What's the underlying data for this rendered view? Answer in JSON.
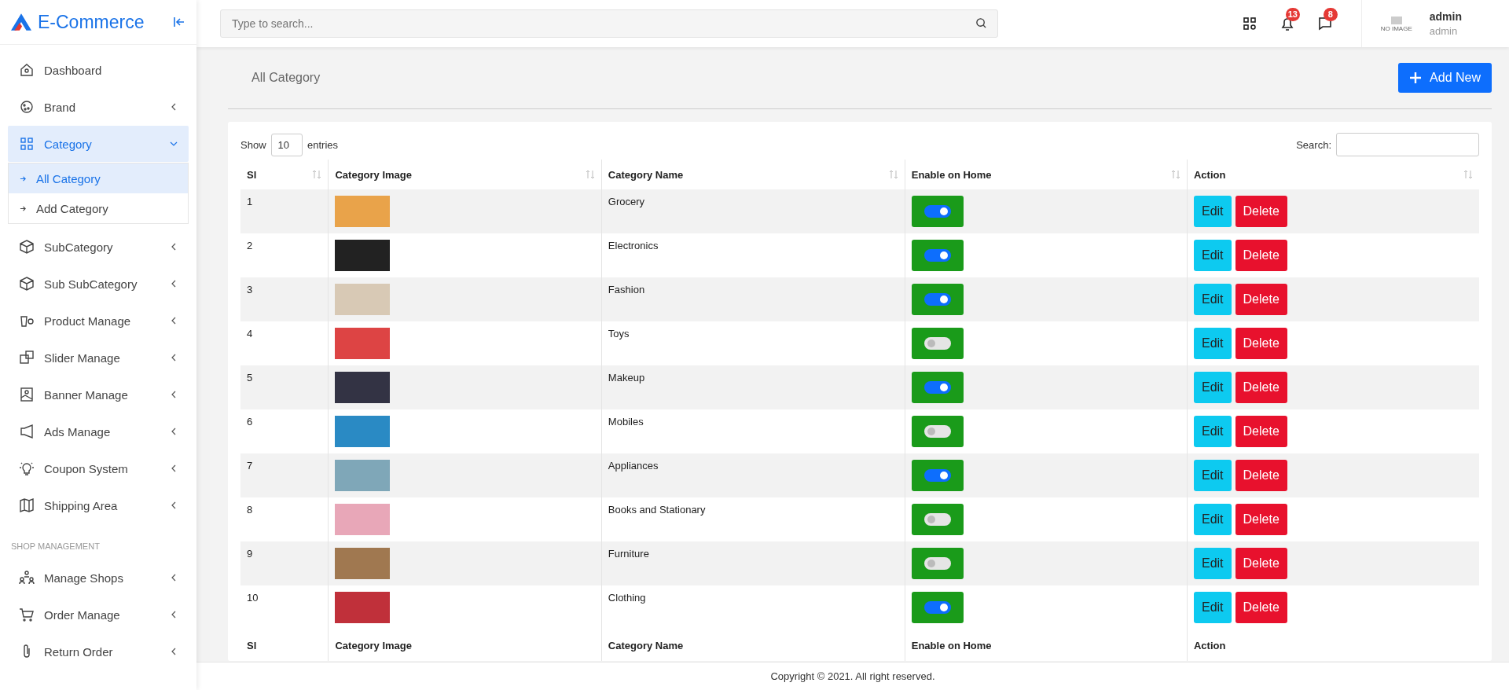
{
  "brand": {
    "name": "E-Commerce"
  },
  "sidebar": {
    "items": [
      {
        "label": "Dashboard",
        "kind": "link"
      },
      {
        "label": "Brand",
        "kind": "menu",
        "expanded": false
      },
      {
        "label": "Category",
        "kind": "menu",
        "expanded": true,
        "children": [
          {
            "label": "All Category",
            "selected": true
          },
          {
            "label": "Add Category",
            "selected": false
          }
        ]
      },
      {
        "label": "SubCategory",
        "kind": "menu",
        "expanded": false
      },
      {
        "label": "Sub SubCategory",
        "kind": "menu",
        "expanded": false
      },
      {
        "label": "Product Manage",
        "kind": "menu",
        "expanded": false
      },
      {
        "label": "Slider Manage",
        "kind": "menu",
        "expanded": false
      },
      {
        "label": "Banner Manage",
        "kind": "menu",
        "expanded": false
      },
      {
        "label": "Ads Manage",
        "kind": "menu",
        "expanded": false
      },
      {
        "label": "Coupon System",
        "kind": "menu",
        "expanded": false
      },
      {
        "label": "Shipping Area",
        "kind": "menu",
        "expanded": false
      },
      {
        "label": "SHOP MANAGEMENT",
        "kind": "heading"
      },
      {
        "label": "Manage Shops",
        "kind": "menu",
        "expanded": false
      },
      {
        "label": "Order Manage",
        "kind": "menu",
        "expanded": false
      },
      {
        "label": "Return Order",
        "kind": "menu",
        "expanded": false
      }
    ]
  },
  "topbar": {
    "search": {
      "placeholder": "Type to search..."
    },
    "notifications": "13",
    "messages": "8",
    "avatar_text": "NO IMAGE",
    "user": {
      "name": "admin",
      "role": "admin"
    }
  },
  "page": {
    "title": "All Category",
    "add_button": "Add New"
  },
  "table": {
    "show_label": "Show",
    "entries_value": "10",
    "entries_label": "entries",
    "search_label": "Search:",
    "columns": [
      "Sl",
      "Category Image",
      "Category Name",
      "Enable on Home",
      "Action"
    ],
    "rows": [
      {
        "sl": "1",
        "name": "Grocery",
        "on": true,
        "edit": "Edit",
        "delete": "Delete"
      },
      {
        "sl": "2",
        "name": "Electronics",
        "on": true,
        "edit": "Edit",
        "delete": "Delete"
      },
      {
        "sl": "3",
        "name": "Fashion",
        "on": true,
        "edit": "Edit",
        "delete": "Delete"
      },
      {
        "sl": "4",
        "name": "Toys",
        "on": false,
        "edit": "Edit",
        "delete": "Delete"
      },
      {
        "sl": "5",
        "name": "Makeup",
        "on": true,
        "edit": "Edit",
        "delete": "Delete"
      },
      {
        "sl": "6",
        "name": "Mobiles",
        "on": false,
        "edit": "Edit",
        "delete": "Delete"
      },
      {
        "sl": "7",
        "name": "Appliances",
        "on": true,
        "edit": "Edit",
        "delete": "Delete"
      },
      {
        "sl": "8",
        "name": "Books and Stationary",
        "on": false,
        "edit": "Edit",
        "delete": "Delete"
      },
      {
        "sl": "9",
        "name": "Furniture",
        "on": false,
        "edit": "Edit",
        "delete": "Delete"
      },
      {
        "sl": "10",
        "name": "Clothing",
        "on": true,
        "edit": "Edit",
        "delete": "Delete"
      }
    ],
    "footer_columns": [
      "Sl",
      "Category Image",
      "Category Name",
      "Enable on Home",
      "Action"
    ]
  },
  "footer": {
    "text": "Copyright © 2021. All right reserved."
  }
}
